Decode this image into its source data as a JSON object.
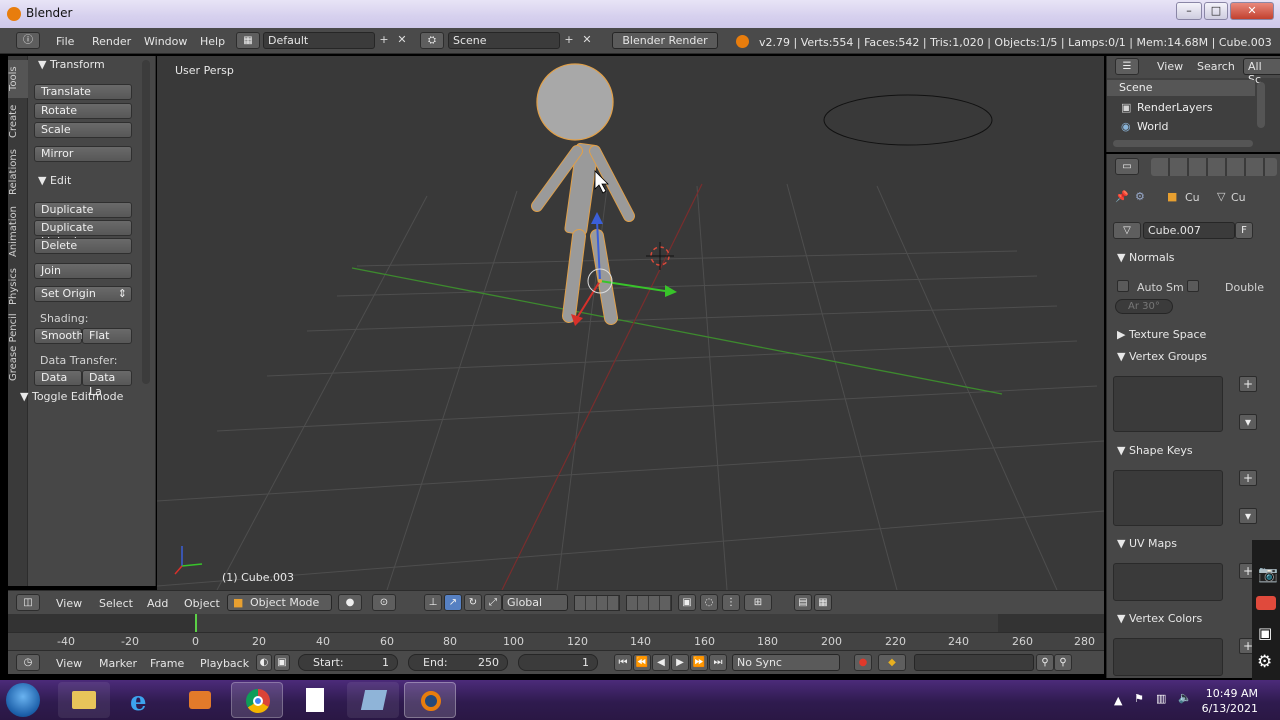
{
  "window": {
    "title": "Blender",
    "icon": "blender-icon",
    "controls": [
      "minimize-icon",
      "maximize-icon",
      "close-icon"
    ]
  },
  "topbar": {
    "menus": [
      "File",
      "Render",
      "Window",
      "Help"
    ],
    "layout": "Default",
    "scene": "Scene",
    "engine": "Blender Render",
    "stats": "v2.79 | Verts:554 | Faces:542 | Tris:1,020 | Objects:1/5 | Lamps:0/1 | Mem:14.68M | Cube.003"
  },
  "tabs": [
    "Tools",
    "Create",
    "Relations",
    "Animation",
    "Physics",
    "Grease Pencil"
  ],
  "toolshelf": {
    "transform_header": "Transform",
    "translate": "Translate",
    "rotate": "Rotate",
    "scale": "Scale",
    "mirror": "Mirror",
    "edit_header": "Edit",
    "duplicate": "Duplicate",
    "duplicate_linked": "Duplicate Linked",
    "delete": "Delete",
    "join": "Join",
    "set_origin": "Set Origin",
    "shading_label": "Shading:",
    "smooth": "Smooth",
    "flat": "Flat",
    "data_transfer_label": "Data Transfer:",
    "data": "Data",
    "data_layout": "Data La",
    "toggle_editmode": "Toggle Editmode"
  },
  "viewport": {
    "view_name": "User Persp",
    "active_object": "(1) Cube.003"
  },
  "viewport_header": {
    "menus": [
      "View",
      "Select",
      "Add",
      "Object"
    ],
    "mode": "Object Mode",
    "orientation": "Global"
  },
  "timeline": {
    "ticks": [
      "-40",
      "-20",
      "0",
      "20",
      "40",
      "60",
      "80",
      "100",
      "120",
      "140",
      "160",
      "180",
      "200",
      "220",
      "240",
      "260",
      "280"
    ],
    "menus": [
      "View",
      "Marker",
      "Frame",
      "Playback"
    ],
    "start_label": "Start:",
    "start": "1",
    "end_label": "End:",
    "end": "250",
    "current": "1",
    "sync": "No Sync"
  },
  "outliner": {
    "view": "View",
    "search": "Search",
    "filter": "All Sc",
    "items": [
      "Scene",
      "RenderLayers",
      "World"
    ]
  },
  "properties": {
    "crumb1": "Cu",
    "crumb2": "Cu",
    "mesh_name": "Cube.007",
    "fake_user": "F",
    "normals": "Normals",
    "auto_smooth": "Auto Sm",
    "double_sided": "Double",
    "angle": "Ar 30°",
    "texture_space": "Texture Space",
    "vertex_groups": "Vertex Groups",
    "shape_keys": "Shape Keys",
    "uv_maps": "UV Maps",
    "vertex_colors": "Vertex Colors"
  },
  "taskbar": {
    "apps": [
      "start-orb-icon",
      "file-explorer-icon",
      "internet-explorer-icon",
      "media-player-icon",
      "chrome-icon",
      "blank-document-icon",
      "notepad-icon",
      "blender-icon"
    ],
    "time": "10:49 AM",
    "date": "6/13/2021"
  }
}
